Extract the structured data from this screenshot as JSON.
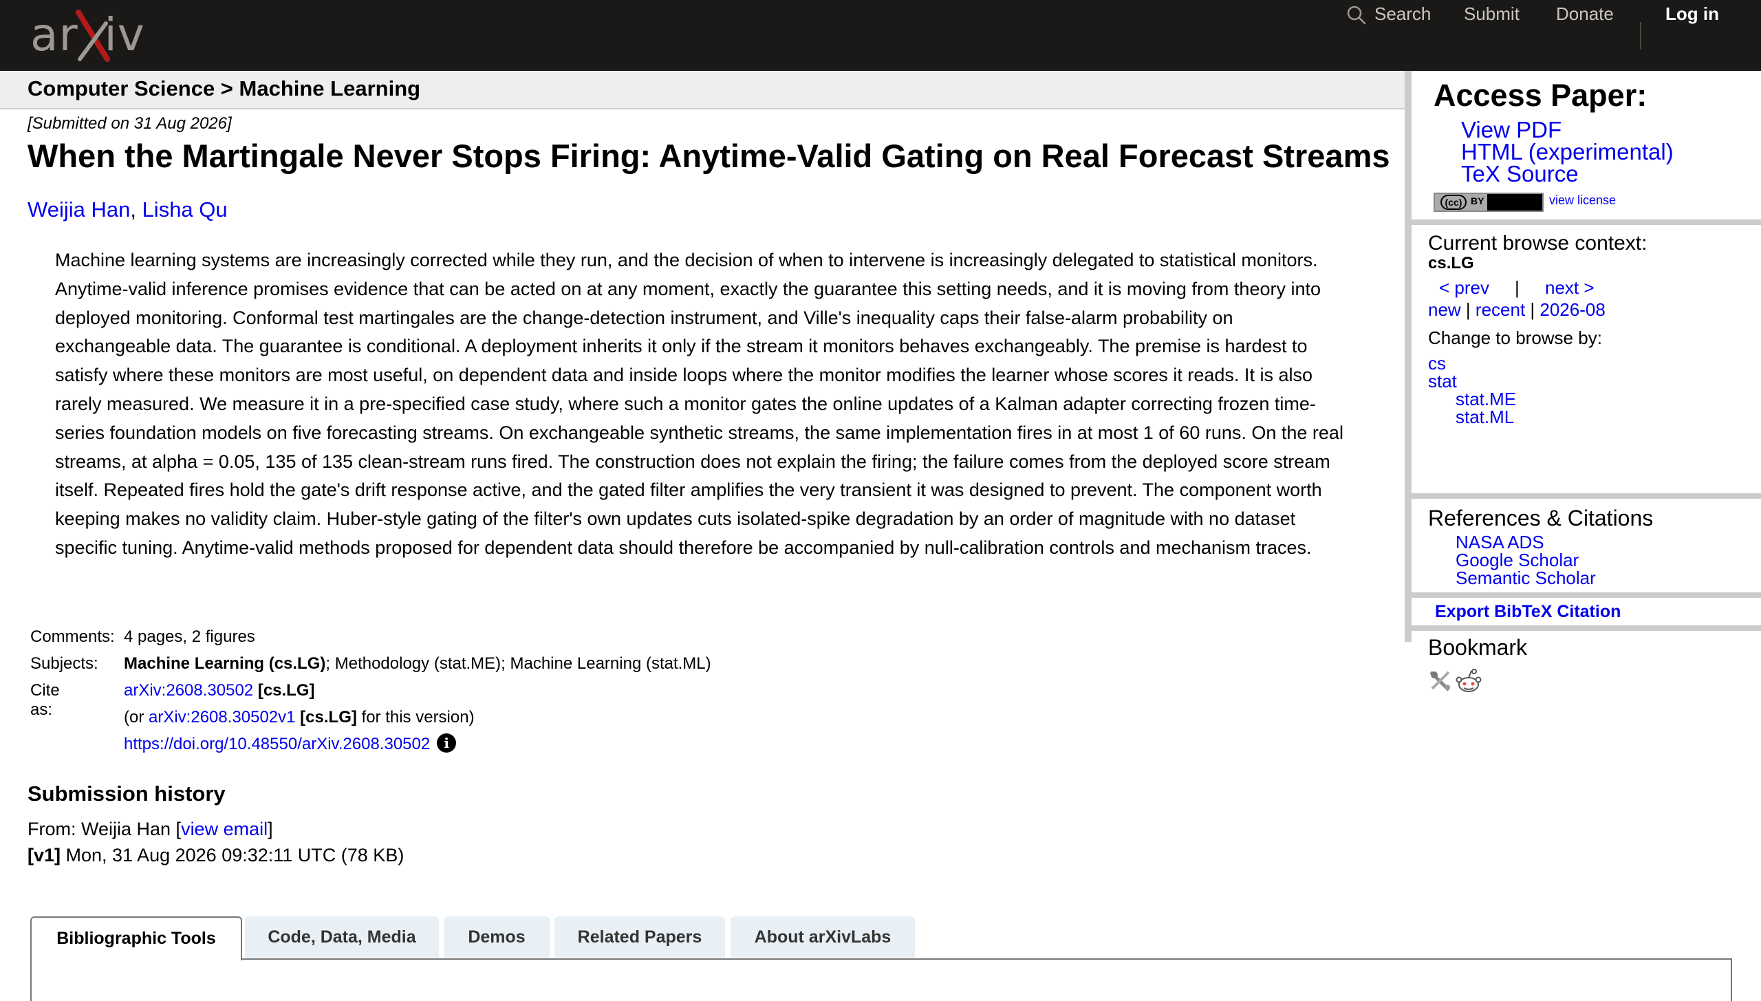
{
  "header": {
    "logo_text": "arXiv",
    "nav": {
      "search": "Search",
      "submit": "Submit",
      "donate": "Donate",
      "login": "Log in"
    },
    "colors": {
      "bar": "#1b1917",
      "logo_x": "#b31b1b"
    }
  },
  "breadcrumb": "Computer Science > Machine Learning",
  "paper": {
    "dateline": "[Submitted on 31 Aug 2026]",
    "title": "When the Martingale Never Stops Firing: Anytime-Valid Gating on Real Forecast Streams",
    "authors": [
      "Weijia Han",
      "Lisha Qu"
    ],
    "author_sep": ", ",
    "abstract": "Machine learning systems are increasingly corrected while they run, and the decision of when to intervene is increasingly delegated to statistical monitors. Anytime-valid inference promises evidence that can be acted on at any moment, exactly the guarantee this setting needs, and it is moving from theory into deployed monitoring. Conformal test martingales are the change-detection instrument, and Ville's inequality caps their false-alarm probability on exchangeable data. The guarantee is conditional. A deployment inherits it only if the stream it monitors behaves exchangeably. The premise is hardest to satisfy where these monitors are most useful, on dependent data and inside loops where the monitor modifies the learner whose scores it reads. It is also rarely measured. We measure it in a pre-specified case study, where such a monitor gates the online updates of a Kalman adapter correcting frozen time-series foundation models on five forecasting streams. On exchangeable synthetic streams, the same implementation fires in at most 1 of 60 runs. On the real streams, at alpha = 0.05, 135 of 135 clean-stream runs fired. The construction does not explain the firing; the failure comes from the deployed score stream itself. Repeated fires hold the gate's drift response active, and the gated filter amplifies the very transient it was designed to prevent. The component worth keeping makes no validity claim. Huber-style gating of the filter's own updates cuts isolated-spike degradation by an order of magnitude with no dataset specific tuning. Anytime-valid methods proposed for dependent data should therefore be accompanied by null-calibration controls and mechanism traces."
  },
  "meta": {
    "comments_label": "Comments:",
    "comments": "4 pages, 2 figures",
    "subjects_label": "Subjects:",
    "subjects_primary": "Machine Learning (cs.LG)",
    "subjects_rest": "; Methodology (stat.ME); Machine Learning (stat.ML)",
    "cite_label": "Cite as:",
    "cite_id": "arXiv:2608.30502",
    "cite_cat": "[cs.LG]",
    "version_prefix": "(or ",
    "version_id": "arXiv:2608.30502v1",
    "version_cat": "[cs.LG]",
    "version_suffix": " for this version)",
    "doi": "https://doi.org/10.48550/arXiv.2608.30502",
    "info_icon": "i"
  },
  "submission": {
    "heading": "Submission history",
    "from_prefix": "From: Weijia Han [",
    "view_email": "view email",
    "from_suffix": "]",
    "v1_tag": "[v1]",
    "v1_text": " Mon, 31 Aug 2026 09:32:11 UTC (78 KB)"
  },
  "tabs": [
    "Bibliographic Tools",
    "Code, Data, Media",
    "Demos",
    "Related Papers",
    "About arXivLabs"
  ],
  "sidebar": {
    "access_title": "Access Paper:",
    "access_links": [
      "View PDF",
      "HTML (experimental)",
      "TeX Source"
    ],
    "license_badge_cc": "(cc)",
    "license_badge_by": "BY",
    "view_license": "view license",
    "context_heading": "Current browse context:",
    "context_cat": "cs.LG",
    "prev": "< prev",
    "sep": "|",
    "next": "next >",
    "new": "new",
    "recent": "recent",
    "month": "2026-08",
    "row_sep": " | ",
    "change_label": "Change to browse by:",
    "browse": [
      "cs",
      "stat",
      "stat.ME",
      "stat.ML"
    ],
    "refs_heading": "References & Citations",
    "refs_links": [
      "NASA ADS",
      "Google Scholar",
      "Semantic Scholar"
    ],
    "export": "Export BibTeX Citation",
    "bookmark_heading": "Bookmark",
    "bookmark_icons": [
      "bibsonomy-icon",
      "reddit-icon"
    ]
  }
}
